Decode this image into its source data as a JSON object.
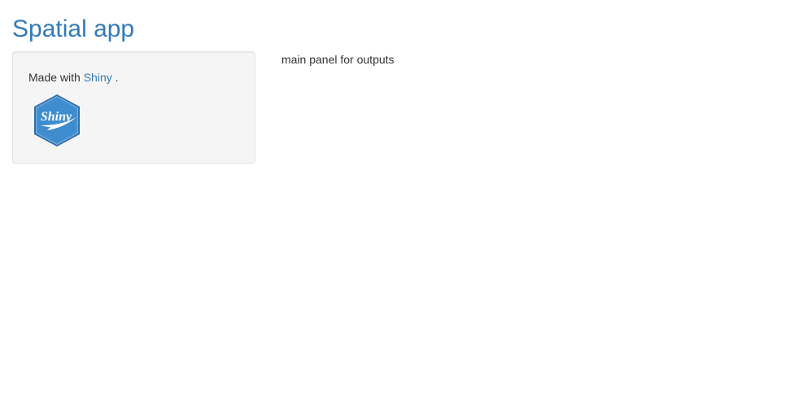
{
  "app": {
    "title": "Spatial app"
  },
  "sidebar": {
    "made_with_prefix": "Made with",
    "link_text": "Shiny",
    "suffix": " .",
    "logo_icon": "shiny-hex-logo-icon",
    "logo_text": "Shiny"
  },
  "main": {
    "text": "main panel for outputs"
  },
  "colors": {
    "link": "#337ab7",
    "sidebar_bg": "#f5f5f5",
    "logo_fill": "#3f8dcf"
  }
}
